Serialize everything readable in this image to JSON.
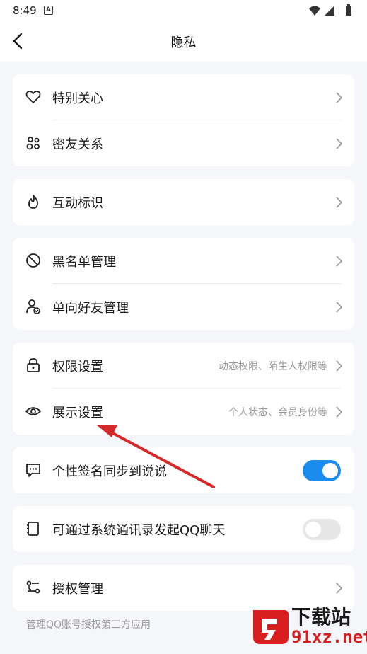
{
  "status_bar": {
    "time": "8:49",
    "notification_letter": "A"
  },
  "header": {
    "title": "隐私"
  },
  "colors": {
    "accent": "#1a8cf0",
    "annotation_arrow": "#d42a2a",
    "watermark_red": "#d81e1e"
  },
  "groups": [
    {
      "items": [
        {
          "label": "特别关心",
          "icon": "heart-icon"
        },
        {
          "label": "密友关系",
          "icon": "friends-icon"
        }
      ]
    },
    {
      "items": [
        {
          "label": "互动标识",
          "icon": "flame-icon"
        }
      ]
    },
    {
      "items": [
        {
          "label": "黑名单管理",
          "icon": "block-icon"
        },
        {
          "label": "单向好友管理",
          "icon": "user-check-icon"
        }
      ]
    },
    {
      "items": [
        {
          "label": "权限设置",
          "desc": "动态权限、陌生人权限等",
          "icon": "lock-icon"
        },
        {
          "label": "展示设置",
          "desc": "个人状态、会员身份等",
          "icon": "eye-icon"
        }
      ]
    },
    {
      "items": [
        {
          "label": "个性签名同步到说说",
          "icon": "comment-icon",
          "toggle": true
        }
      ]
    },
    {
      "items": [
        {
          "label": "可通过系统通讯录发起QQ聊天",
          "icon": "contacts-book-icon",
          "toggle": false
        }
      ]
    },
    {
      "items": [
        {
          "label": "授权管理",
          "icon": "authorize-icon"
        }
      ]
    }
  ],
  "footnote": "管理QQ账号授权第三方应用",
  "watermark": {
    "brand": "下载站",
    "domain": "91xz.net"
  }
}
